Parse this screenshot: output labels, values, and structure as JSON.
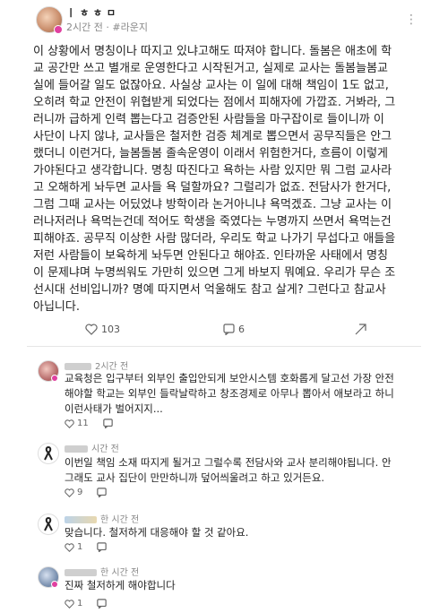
{
  "post": {
    "author": "ㅣ ㅎ ㅎ ㅁ",
    "time": "2시간 전",
    "category": "#라운지",
    "body": "이 상황에서 명칭이나 따지고 있냐고해도 따져야 합니다. 돌봄은 애초에 학\n교 공간만 쓰고 별개로 운영한다고 시작된거고, 실제로 교사는 돌봄늘봄교\n실에 들어갈 일도 없잖아요. 사실상 교사는 이 일에 대해 책임이 1도 없고,\n오히려 학교 안전이 위협받게 되었다는 점에서 피해자에 가깝죠. 거봐라, 그\n러니까 급하게 인력 뽑는다고 검증안된 사람들을 마구잡이로 들이니까 이\n사단이 나지 않냐, 교사들은 철저한 검증 체계로 뽑으면서 공무직들은 안그\n랬더니 이런거다, 늘봄돌봄 졸속운영이 이래서 위험한거다, 흐름이 이렇게\n가야된다고 생각합니다. 명칭 따진다고 욕하는 사람 있지만 뭐 그럼 교사라\n고 오해하게 놔두면 교사들 욕 덜할까요? 그럴리가 없죠. 전담사가 한거다,\n그럼 그때 교사는 어딨었냐 방학이라 논거아니냐 욕먹겠죠. 그냥 교사는 이\n러나저러나 욕먹는건데 적어도 학생을 죽였다는 누명까지 쓰면서 욕먹는건\n피해야죠. 공무직 이상한 사람 많더라, 우리도 학교 나가기 무섭다고 애들을\n저런 사람들이 보육하게 놔두면 안된다고 해야죠. 인타까운 사태에서 명칭\n이 문제냐며 누명씌워도 가만히 있으면 그게 바보지 뭐예요. 우리가 무슨 조\n선시대 선비입니까? 명예 따지면서 억울해도 참고 살게? 그런다고 참교사\n아닙니다.",
    "likes": "103",
    "comments": "6"
  },
  "comments": [
    {
      "time": "2시간 전",
      "text": "교육청은 입구부터 외부인 출입안되게 보안시스템 호화롭게 달고선 가장 안전\n해야할 학교는 외부인 들락날락하고 창조경제로 아무나 뽑아서 애보라고 하니\n이런사태가 벌어지지...",
      "likes": "11"
    },
    {
      "time": "시간 전",
      "text": "이번일 책임 소재 따지게 될거고 그럴수록 전담사와 교사 분리해야됩니다. 안\n그래도 교사 집단이 만만하니까 덮어씌울려고 하고 있거든요.",
      "likes": "9"
    },
    {
      "time": "한 시간 전",
      "text": "맞습니다. 철저하게 대응해야 할 것 같아요.",
      "likes": "1"
    },
    {
      "time": "한 시간 전",
      "text": "진짜 철저하게 해야합니다",
      "likes": "1"
    }
  ],
  "colors": {
    "accent": "#e040a0",
    "muted": "#888888"
  }
}
